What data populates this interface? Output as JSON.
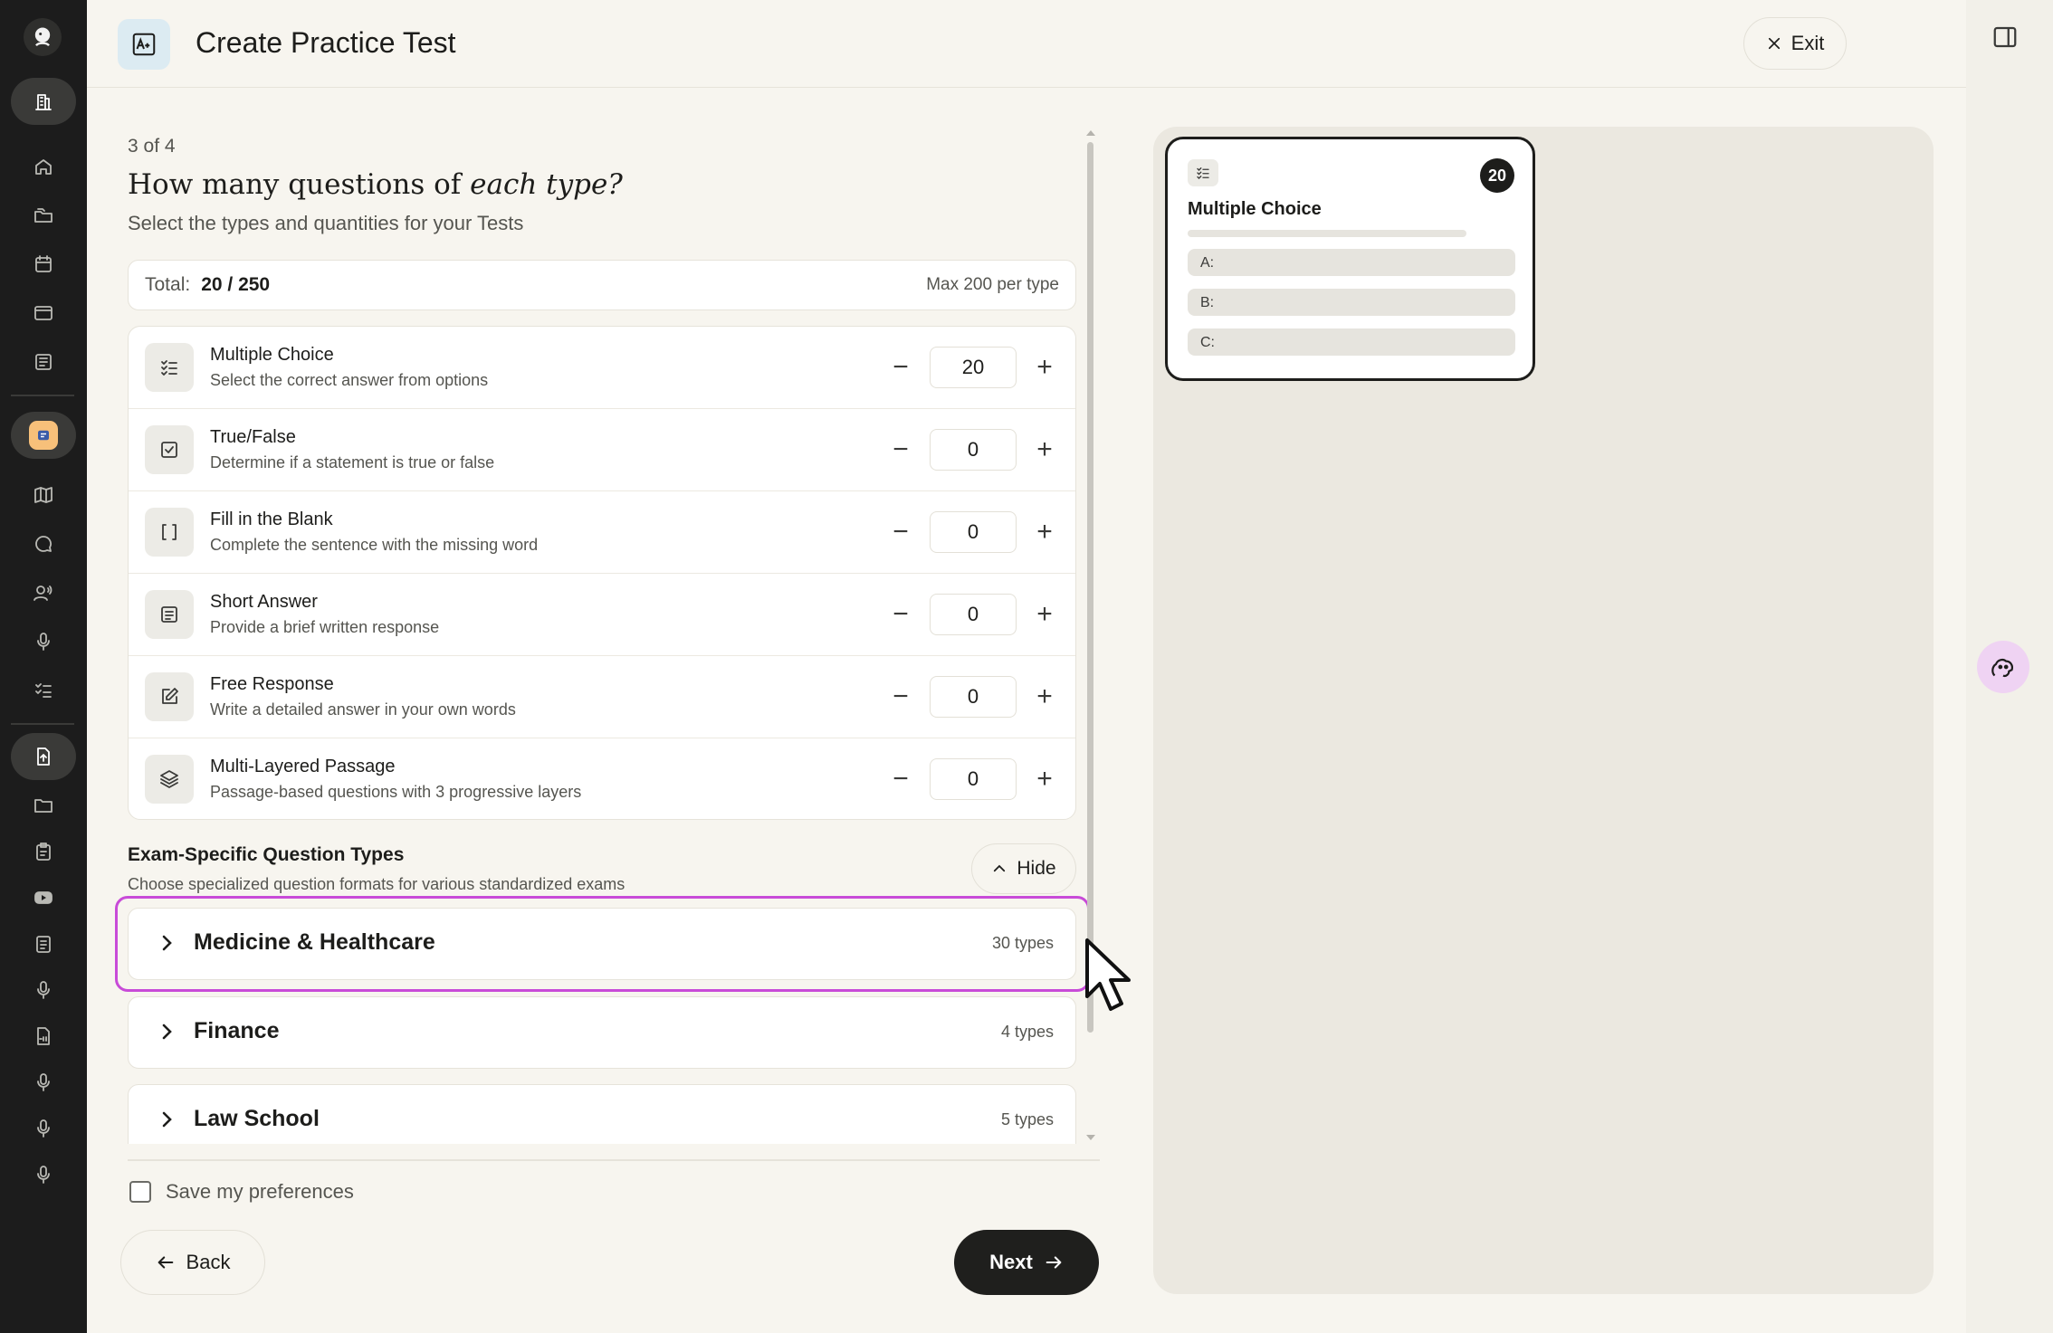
{
  "app": {
    "page_title": "Create Practice Test",
    "exit_label": "Exit"
  },
  "sidebar": {
    "icons": [
      "logo-icon",
      "building-icon",
      "home-icon",
      "folders-icon",
      "calendar-icon",
      "window-icon",
      "library-icon",
      "app-icon",
      "map-icon",
      "chat-icon",
      "voice-user-icon",
      "mic-icon",
      "checklist-icon",
      "upload-file-icon",
      "folder-icon",
      "clipboard-icon",
      "youtube-icon",
      "notes-icon",
      "mic-icon",
      "pdf-icon",
      "mic-icon",
      "mic-icon",
      "mic-icon"
    ]
  },
  "form": {
    "step": "3 of 4",
    "question_prefix": "How many questions of ",
    "question_emphasis": "each type?",
    "subtitle": "Select the types and quantities for your Tests",
    "total_label": "Total:",
    "total_value": "20 / 250",
    "max_label": "Max 200 per type",
    "types": [
      {
        "name": "Multiple Choice",
        "desc": "Select the correct answer from options",
        "qty": "20",
        "icon": "list-check-icon"
      },
      {
        "name": "True/False",
        "desc": "Determine if a statement is true or false",
        "qty": "0",
        "icon": "checkbox-icon"
      },
      {
        "name": "Fill in the Blank",
        "desc": "Complete the sentence with the missing word",
        "qty": "0",
        "icon": "brackets-icon"
      },
      {
        "name": "Short Answer",
        "desc": "Provide a brief written response",
        "qty": "0",
        "icon": "text-lines-icon"
      },
      {
        "name": "Free Response",
        "desc": "Write a detailed answer in your own words",
        "qty": "0",
        "icon": "edit-icon"
      },
      {
        "name": "Multi-Layered Passage",
        "desc": "Passage-based questions with 3 progressive layers",
        "qty": "0",
        "icon": "layers-icon"
      }
    ],
    "minus_glyph": "−",
    "plus_glyph": "+",
    "exam_title": "Exam-Specific Question Types",
    "exam_subtitle": "Choose specialized question formats for various standardized exams",
    "hide_label": "Hide",
    "categories": [
      {
        "name": "Medicine & Healthcare",
        "count": "30 types"
      },
      {
        "name": "Finance",
        "count": "4 types"
      },
      {
        "name": "Law School",
        "count": "5 types"
      }
    ],
    "save_prefs_label": "Save my preferences",
    "back_label": "Back",
    "next_label": "Next"
  },
  "preview": {
    "card_title": "Multiple Choice",
    "count": "20",
    "options": [
      "A:",
      "B:",
      "C:"
    ]
  },
  "colors": {
    "highlight": "#c84bd8",
    "primary_button": "#1f1f1d",
    "background": "#f7f5ef",
    "rail": "#1c1c1c"
  }
}
